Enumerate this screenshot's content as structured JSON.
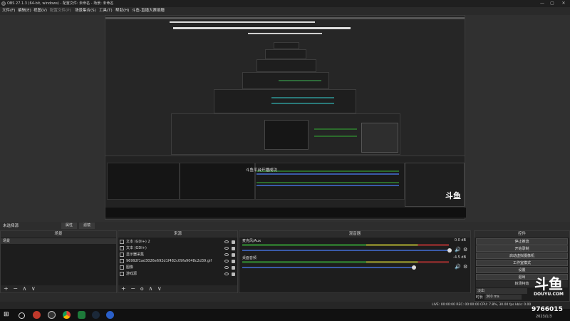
{
  "window": {
    "title": "OBS 27.1.3 (64-bit, windows) - 配置文件: 未命名 - 场景: 未命名",
    "controls": [
      "—",
      "▢",
      "✕"
    ]
  },
  "menu": [
    "文件(F)",
    "编辑(E)",
    "视图(V)",
    "配置文件(P)",
    "场景集合(S)",
    "工具(T)",
    "帮助(H)",
    "斗鱼-直播大赛捐赠"
  ],
  "preview": {
    "status_message": "斗鱼平台开播成功",
    "logo_text": "斗鱼",
    "logo_sub": "DOUYU.COM"
  },
  "scene_bar": {
    "label": "未选择源",
    "properties_btn": "属性",
    "filters_btn": "滤镜"
  },
  "scenes": {
    "header": "场景",
    "items": [
      "场景"
    ],
    "footer": [
      "+",
      "−",
      "∧",
      "∨"
    ]
  },
  "sources": {
    "header": "来源",
    "items": [
      {
        "icon": "text-icon",
        "label": "文本 (GDI+) 2"
      },
      {
        "icon": "text-icon",
        "label": "文本 (GDI+)"
      },
      {
        "icon": "display-capture-icon",
        "label": "显示器采集"
      },
      {
        "icon": "image-icon",
        "label": "96992f1ad3026e692d1f482c09fa9048c2d39.gif"
      },
      {
        "icon": "image-icon",
        "label": "图像"
      },
      {
        "icon": "window-icon",
        "label": "游戏源"
      }
    ],
    "footer": [
      "+",
      "−",
      "⚙",
      "∧",
      "∨"
    ]
  },
  "mixer": {
    "header": "混音器",
    "tracks": [
      {
        "name": "麦克风/Aux",
        "db": "0.0 dB"
      },
      {
        "name": "桌面音频",
        "db": "-4.5 dB"
      }
    ]
  },
  "controls": {
    "header": "控件",
    "buttons": [
      "停止推流",
      "开始录制",
      "启动虚拟摄像机",
      "工作室模式",
      "设置",
      "退出"
    ],
    "transitions_label": "转场特效",
    "transition_value": "淡出",
    "duration_label": "时长",
    "duration_value": "300 ms"
  },
  "status": {
    "text": "LIVE: 00:00:00   REC: 00:00:00   CPU: 7.8%, 30.00 fps   kb/s: 0.00"
  },
  "taskbar": {
    "overlay_id": "9766015",
    "date": "2023/1/3"
  }
}
